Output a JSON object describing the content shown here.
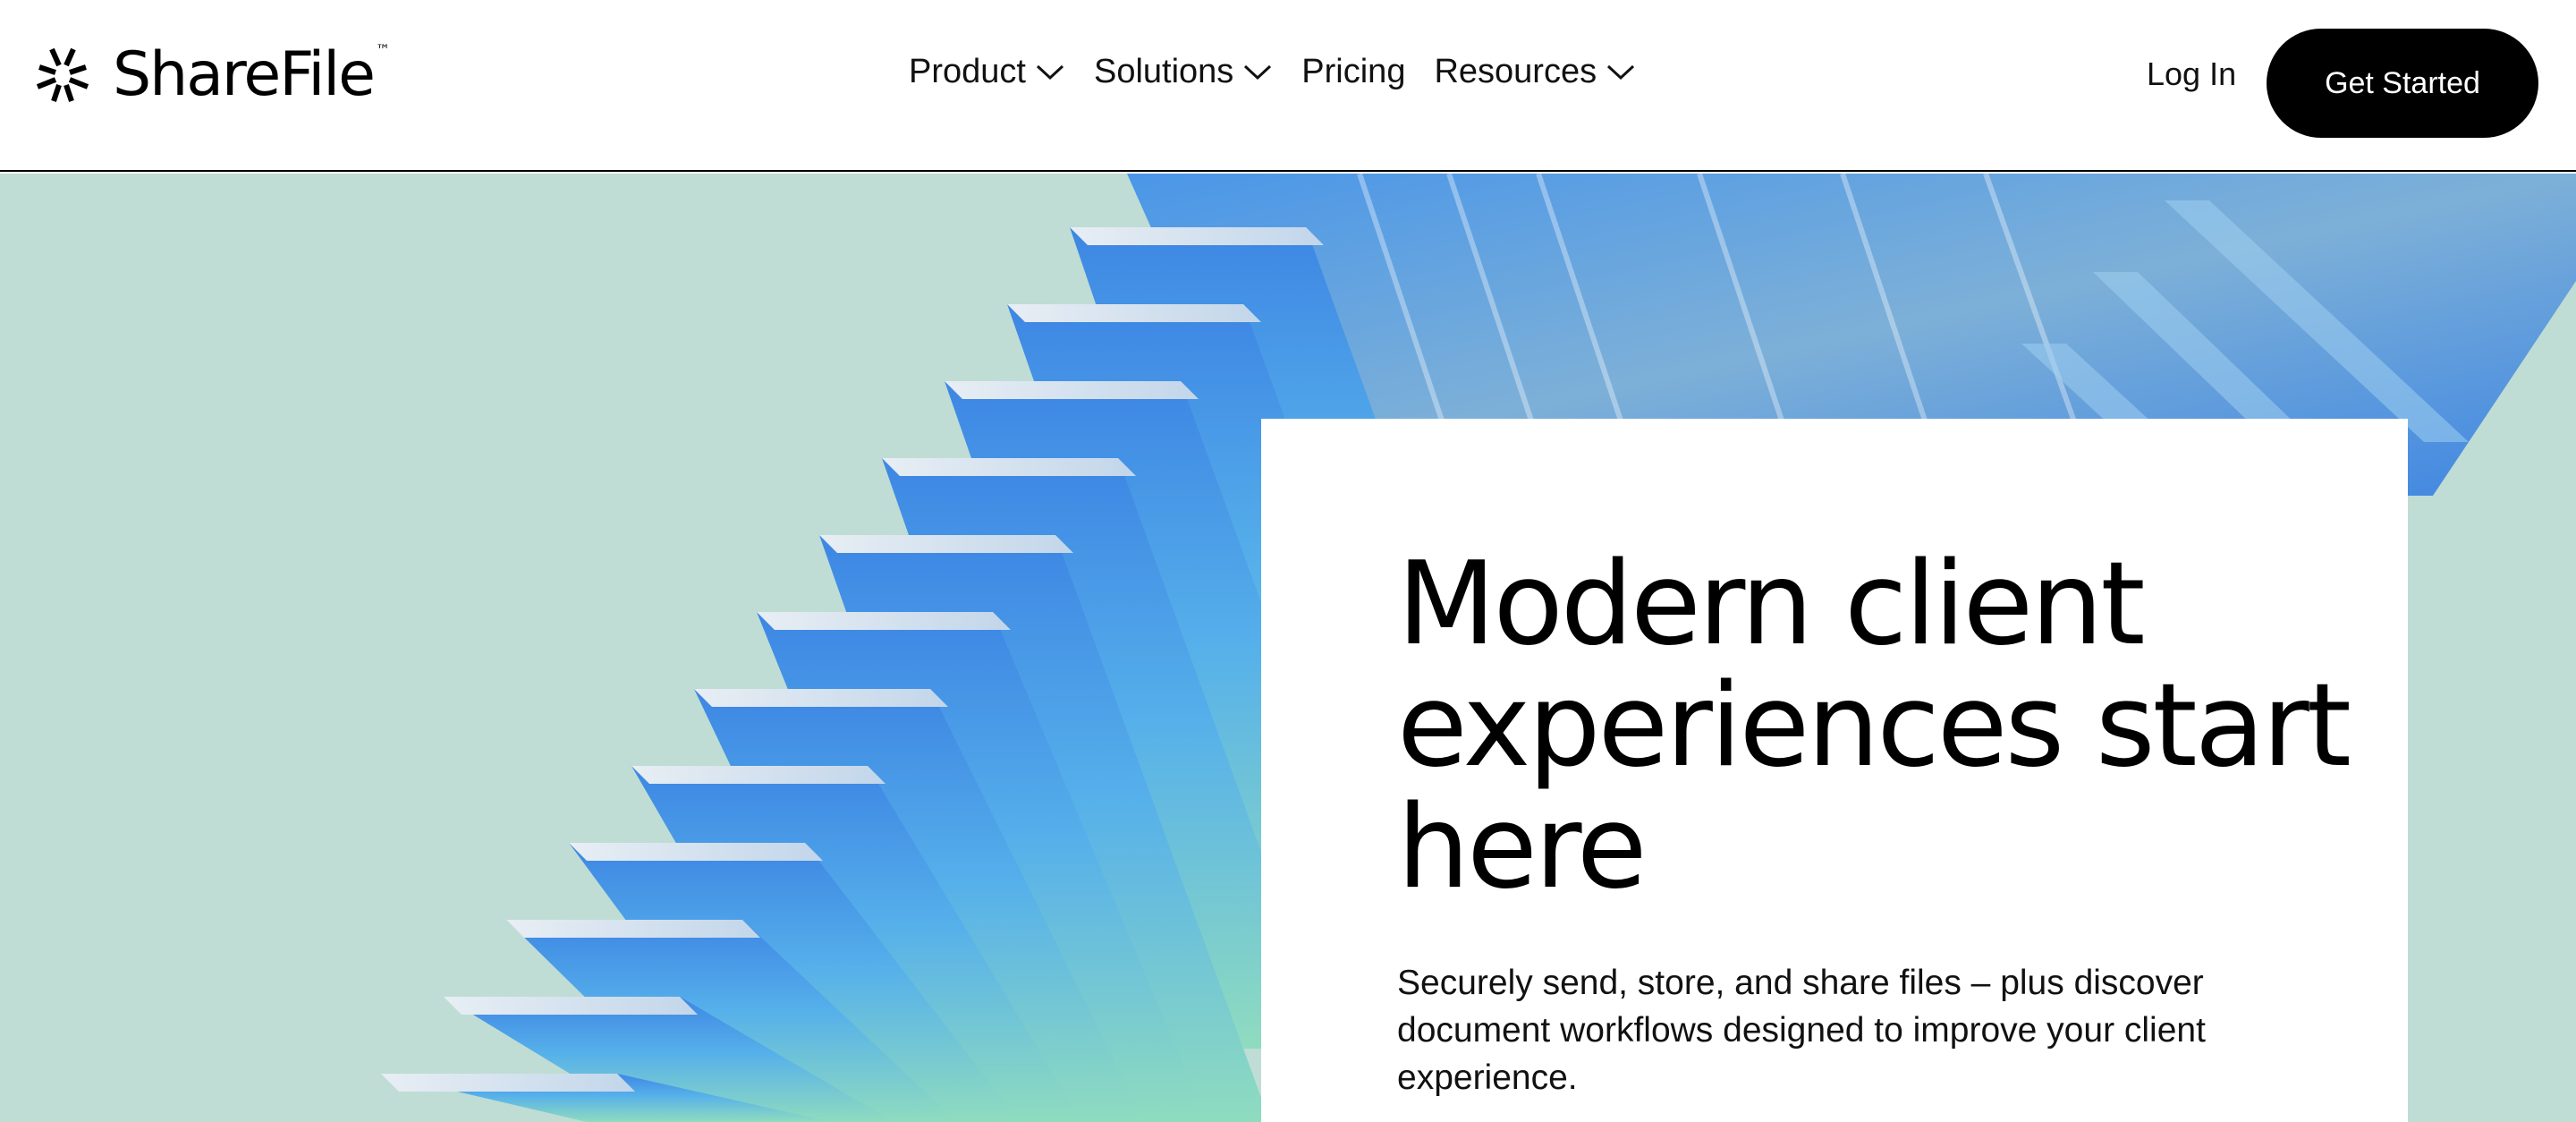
{
  "brand": {
    "name": "ShareFile",
    "trademark": "™",
    "logo_icon": "sharefile-burst-icon"
  },
  "nav": {
    "items": [
      {
        "label": "Product",
        "has_dropdown": true
      },
      {
        "label": "Solutions",
        "has_dropdown": true
      },
      {
        "label": "Pricing",
        "has_dropdown": false
      },
      {
        "label": "Resources",
        "has_dropdown": true
      }
    ],
    "dropdown_icon": "chevron-down-icon"
  },
  "header_actions": {
    "login_label": "Log In",
    "cta_label": "Get Started"
  },
  "hero": {
    "headline": "Modern client experiences start here",
    "subtext": "Securely send, store, and share files – plus discover document workflows designed to improve your client experience.",
    "colors": {
      "background": "#bfddd4",
      "blue": "#3f8ee6",
      "light_blue": "#5bb6ea",
      "green": "#8fdcbf",
      "cta": "#000000"
    }
  }
}
